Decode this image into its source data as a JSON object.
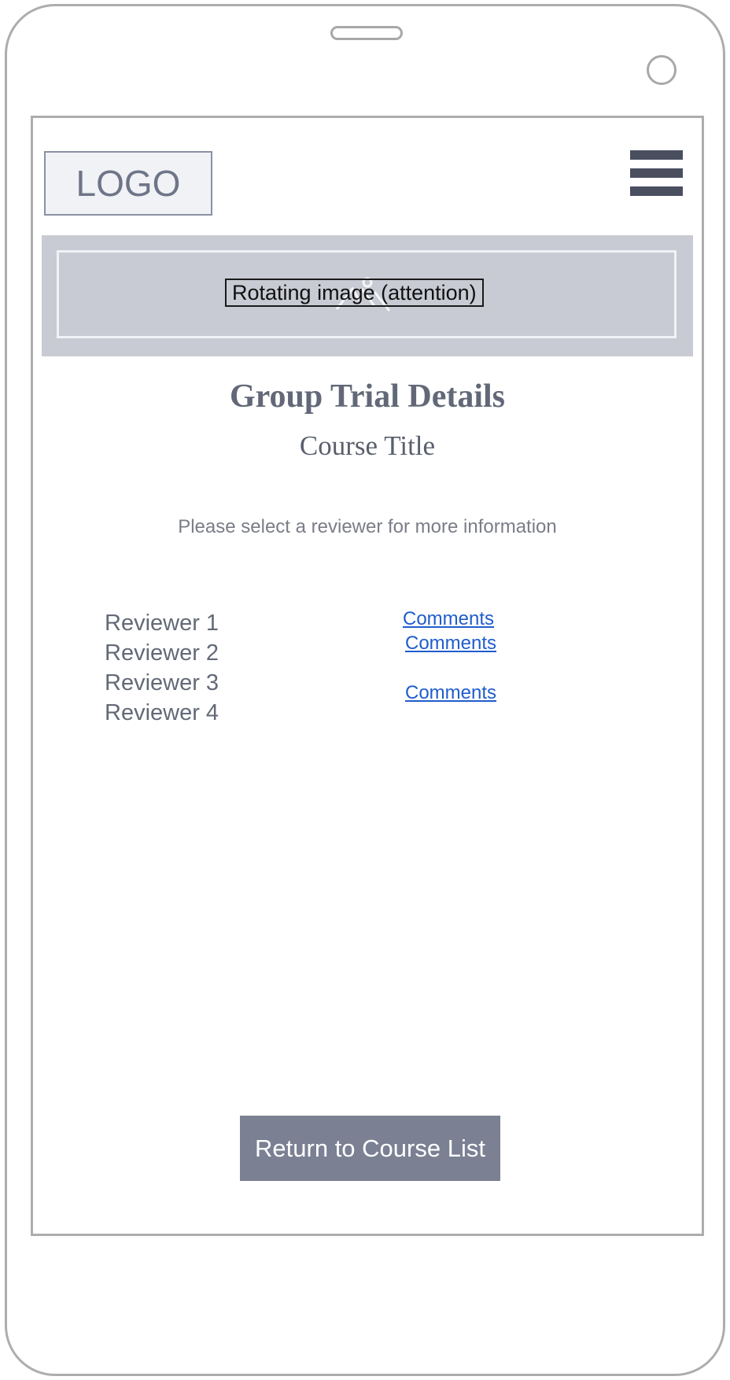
{
  "header": {
    "logo_text": "LOGO",
    "menu_icon": "hamburger-menu-icon"
  },
  "banner": {
    "label": "Rotating image (attention)",
    "icon": "image-placeholder-icon"
  },
  "page": {
    "title": "Group Trial Details",
    "course_title": "Course Title",
    "instruction": "Please select a reviewer for more information"
  },
  "reviewers": [
    {
      "name": "Reviewer 1"
    },
    {
      "name": "Reviewer 2"
    },
    {
      "name": "Reviewer 3"
    },
    {
      "name": "Reviewer 4"
    }
  ],
  "comments": [
    {
      "label": "Comments"
    },
    {
      "label": "Comments"
    },
    {
      "label": "Comments"
    }
  ],
  "footer": {
    "return_label": "Return to Course List"
  },
  "colors": {
    "banner_background": "#c8cbd3",
    "button_background": "#7b8193",
    "link": "#1f5dcc",
    "text": "#636977",
    "menu_bars": "#4a4f60"
  }
}
